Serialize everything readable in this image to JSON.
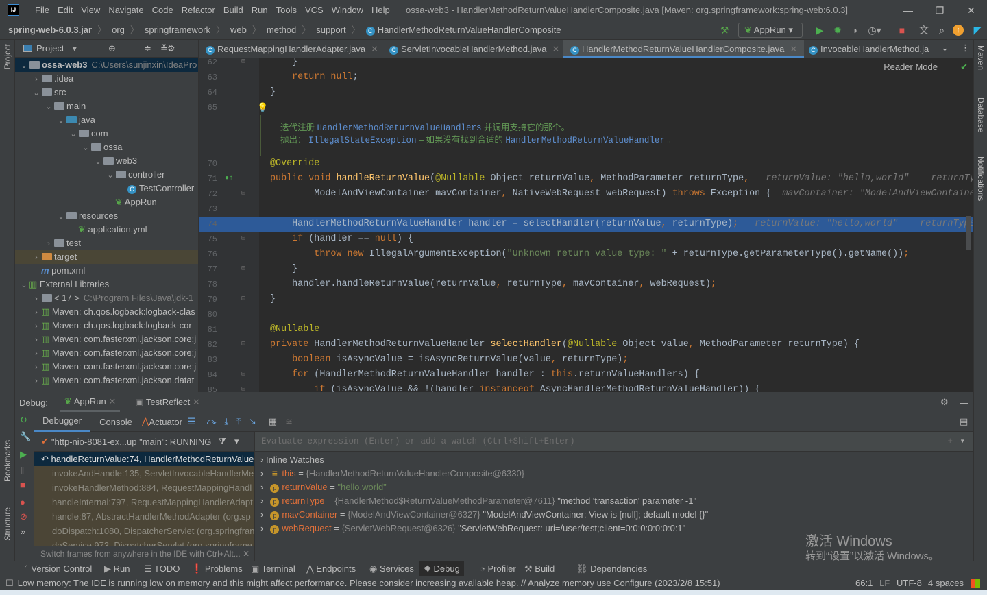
{
  "menubar": {
    "items": [
      "File",
      "Edit",
      "View",
      "Navigate",
      "Code",
      "Refactor",
      "Build",
      "Run",
      "Tools",
      "VCS",
      "Window",
      "Help"
    ],
    "title": "ossa-web3 - HandlerMethodReturnValueHandlerComposite.java [Maven: org.springframework:spring-web:6.0.3]"
  },
  "breadcrumb": [
    "spring-web-6.0.3.jar",
    "org",
    "springframework",
    "web",
    "method",
    "support",
    "HandlerMethodReturnValueHandlerComposite"
  ],
  "toolbar": {
    "run_config": "AppRun"
  },
  "left_strip": {
    "project": "Project",
    "bookmarks": "Bookmarks",
    "structure": "Structure"
  },
  "right_strip": {
    "maven": "Maven",
    "database": "Database",
    "notifications": "Notifications"
  },
  "project": {
    "title": "Project",
    "tree": [
      {
        "label": "ossa-web3",
        "hint": "C:\\Users\\sunjinxin\\IdeaPro",
        "d": 0,
        "a": "open",
        "icon": "module",
        "sel": true,
        "bold": true
      },
      {
        "label": ".idea",
        "d": 1,
        "a": "closed",
        "icon": "folder"
      },
      {
        "label": "src",
        "d": 1,
        "a": "open",
        "icon": "folder"
      },
      {
        "label": "main",
        "d": 2,
        "a": "open",
        "icon": "folder"
      },
      {
        "label": "java",
        "d": 3,
        "a": "open",
        "icon": "src-folder"
      },
      {
        "label": "com",
        "d": 4,
        "a": "open",
        "icon": "package"
      },
      {
        "label": "ossa",
        "d": 5,
        "a": "open",
        "icon": "package"
      },
      {
        "label": "web3",
        "d": 6,
        "a": "open",
        "icon": "package"
      },
      {
        "label": "controller",
        "d": 7,
        "a": "open",
        "icon": "package"
      },
      {
        "label": "TestController",
        "d": 8,
        "a": "none",
        "icon": "class"
      },
      {
        "label": "AppRun",
        "d": 7,
        "a": "none",
        "icon": "spring"
      },
      {
        "label": "resources",
        "d": 3,
        "a": "open",
        "icon": "res-folder"
      },
      {
        "label": "application.yml",
        "d": 4,
        "a": "none",
        "icon": "yml"
      },
      {
        "label": "test",
        "d": 2,
        "a": "closed",
        "icon": "folder"
      },
      {
        "label": "target",
        "d": 1,
        "a": "closed",
        "icon": "excluded-folder",
        "exc": true
      },
      {
        "label": "pom.xml",
        "d": 1,
        "a": "none",
        "icon": "maven"
      },
      {
        "label": "External Libraries",
        "d": 0,
        "a": "open",
        "icon": "libraries"
      },
      {
        "label": "< 17 >",
        "hint": "C:\\Program Files\\Java\\jdk-1",
        "d": 1,
        "a": "closed",
        "icon": "jdk"
      },
      {
        "label": "Maven: ch.qos.logback:logback-clas",
        "d": 1,
        "a": "closed",
        "icon": "lib"
      },
      {
        "label": "Maven: ch.qos.logback:logback-cor",
        "d": 1,
        "a": "closed",
        "icon": "lib"
      },
      {
        "label": "Maven: com.fasterxml.jackson.core:j",
        "d": 1,
        "a": "closed",
        "icon": "lib"
      },
      {
        "label": "Maven: com.fasterxml.jackson.core:j",
        "d": 1,
        "a": "closed",
        "icon": "lib"
      },
      {
        "label": "Maven: com.fasterxml.jackson.core:j",
        "d": 1,
        "a": "closed",
        "icon": "lib"
      },
      {
        "label": "Maven: com.fasterxml.jackson.datat",
        "d": 1,
        "a": "closed",
        "icon": "lib"
      }
    ]
  },
  "tabs": [
    {
      "label": "RequestMappingHandlerAdapter.java",
      "active": false
    },
    {
      "label": "ServletInvocableHandlerMethod.java",
      "active": false
    },
    {
      "label": "HandlerMethodReturnValueHandlerComposite.java",
      "active": true
    },
    {
      "label": "InvocableHandlerMethod.ja",
      "active": false
    }
  ],
  "editor": {
    "reader_mode": "Reader Mode",
    "doc": {
      "line1": [
        "迭代注册 ",
        "HandlerMethodReturnValueHandlers",
        " 并调用支持它的那个。"
      ],
      "line2": [
        "抛出： ",
        "IllegalStateException",
        " – 如果没有找到合适的 ",
        "HandlerMethodReturnValueHandler",
        " 。"
      ]
    },
    "lines": [
      {
        "n": "62",
        "t": [
          [
            "tx",
            "    }"
          ]
        ]
      },
      {
        "n": "63",
        "t": [
          [
            "kw",
            "    return null"
          ],
          [
            "tx",
            ";"
          ]
        ]
      },
      {
        "n": "64",
        "t": [
          [
            "tx",
            "}"
          ]
        ]
      },
      {
        "n": "65",
        "t": []
      },
      {
        "doc": true
      },
      {
        "n": "70",
        "t": [
          [
            "an",
            "@Override"
          ]
        ]
      },
      {
        "n": "71",
        "t": [
          [
            "kw",
            "public void "
          ],
          [
            "fn",
            "handleReturnValue"
          ],
          [
            "tx",
            "("
          ],
          [
            "an",
            "@Nullable"
          ],
          [
            "tx",
            " Object returnValue"
          ],
          [
            "kw",
            ", "
          ],
          [
            "tx",
            "MethodParameter returnType"
          ],
          [
            "kw",
            ","
          ],
          [
            "ih",
            "   returnValue: \"hello,world\"    returnTyp"
          ]
        ]
      },
      {
        "n": "72",
        "t": [
          [
            "tx",
            "        ModelAndViewContainer mavContainer"
          ],
          [
            "kw",
            ", "
          ],
          [
            "tx",
            "NativeWebRequest webRequest) "
          ],
          [
            "kw",
            "throws "
          ],
          [
            "tx",
            "Exception {"
          ],
          [
            "ih",
            "  mavContainer: \"ModelAndViewContaine"
          ]
        ]
      },
      {
        "n": "73",
        "t": []
      },
      {
        "n": "74",
        "hl": true,
        "t": [
          [
            "tx",
            "    HandlerMethodReturnValueHandler handler = selectHandler(returnValue"
          ],
          [
            "kw",
            ", "
          ],
          [
            "tx",
            "returnType)"
          ],
          [
            "kw",
            ";"
          ],
          [
            "ih",
            "   returnValue: \"hello,world\"    returnType:"
          ]
        ]
      },
      {
        "n": "75",
        "t": [
          [
            "kw",
            "    if "
          ],
          [
            "tx",
            "(handler == "
          ],
          [
            "kw",
            "null"
          ],
          [
            "tx",
            ") {"
          ]
        ]
      },
      {
        "n": "76",
        "t": [
          [
            "kw",
            "        throw new "
          ],
          [
            "tx",
            "IllegalArgumentException("
          ],
          [
            "str",
            "\"Unknown return value type: \""
          ],
          [
            "tx",
            " + returnType.getParameterType().getName())"
          ],
          [
            "kw",
            ";"
          ]
        ]
      },
      {
        "n": "77",
        "t": [
          [
            "tx",
            "    }"
          ]
        ]
      },
      {
        "n": "78",
        "t": [
          [
            "tx",
            "    handler.handleReturnValue(returnValue"
          ],
          [
            "kw",
            ", "
          ],
          [
            "tx",
            "returnType"
          ],
          [
            "kw",
            ", "
          ],
          [
            "tx",
            "mavContainer"
          ],
          [
            "kw",
            ", "
          ],
          [
            "tx",
            "webRequest)"
          ],
          [
            "kw",
            ";"
          ]
        ]
      },
      {
        "n": "79",
        "t": [
          [
            "tx",
            "}"
          ]
        ]
      },
      {
        "n": "80",
        "t": []
      },
      {
        "n": "81",
        "t": [
          [
            "an",
            "@Nullable"
          ]
        ]
      },
      {
        "n": "82",
        "t": [
          [
            "kw",
            "private "
          ],
          [
            "tx",
            "HandlerMethodReturnValueHandler "
          ],
          [
            "fn",
            "selectHandler"
          ],
          [
            "tx",
            "("
          ],
          [
            "an",
            "@Nullable"
          ],
          [
            "tx",
            " Object value"
          ],
          [
            "kw",
            ", "
          ],
          [
            "tx",
            "MethodParameter returnType) {"
          ]
        ]
      },
      {
        "n": "83",
        "t": [
          [
            "kw",
            "    boolean "
          ],
          [
            "tx",
            "isAsyncValue = isAsyncReturnValue(value"
          ],
          [
            "kw",
            ", "
          ],
          [
            "tx",
            "returnType)"
          ],
          [
            "kw",
            ";"
          ]
        ]
      },
      {
        "n": "84",
        "t": [
          [
            "kw",
            "    for "
          ],
          [
            "tx",
            "(HandlerMethodReturnValueHandler handler : "
          ],
          [
            "kw",
            "this"
          ],
          [
            "tx",
            ".returnValueHandlers) {"
          ]
        ]
      },
      {
        "n": "85",
        "t": [
          [
            "kw",
            "        if "
          ],
          [
            "tx",
            "(isAsyncValue && !(handler "
          ],
          [
            "kw",
            "instanceof "
          ],
          [
            "tx",
            "AsyncHandlerMethodReturnValueHandler)) {"
          ]
        ]
      }
    ]
  },
  "debug": {
    "label": "Debug:",
    "sessions": [
      "AppRun",
      "TestReflect"
    ],
    "tabs": [
      "Debugger",
      "Console",
      "Actuator"
    ],
    "thread": "\"http-nio-8081-ex...up \"main\": RUNNING",
    "frames": [
      {
        "text": "handleReturnValue:74, HandlerMethodReturnValue",
        "sel": true
      },
      {
        "text": "invokeAndHandle:135, ServletInvocableHandlerMet"
      },
      {
        "text": "invokeHandlerMethod:884, RequestMappingHandl"
      },
      {
        "text": "handleInternal:797, RequestMappingHandlerAdapt"
      },
      {
        "text": "handle:87, AbstractHandlerMethodAdapter (org.sp"
      },
      {
        "text": "doDispatch:1080, DispatcherServlet (org.springfran"
      },
      {
        "text": "doService:973, DispatcherServlet (org.springframe"
      }
    ],
    "frames_tip": "Switch frames from anywhere in the IDE with Ctrl+Alt...",
    "eval_placeholder": "Evaluate expression (Enter) or add a watch (Ctrl+Shift+Enter)",
    "inline_watches": "Inline Watches",
    "vars": [
      {
        "name": "this",
        "kind": "this",
        "value": "{HandlerMethodReturnValueHandlerComposite@6330}",
        "extra": ""
      },
      {
        "name": "returnValue",
        "kind": "param",
        "value": "",
        "str": "\"hello,world\"",
        "extra": ""
      },
      {
        "name": "returnType",
        "kind": "param",
        "value": "{HandlerMethod$ReturnValueMethodParameter@7611}",
        "extra": "\"method 'transaction' parameter -1\""
      },
      {
        "name": "mavContainer",
        "kind": "param",
        "value": "{ModelAndViewContainer@6327}",
        "extra": "\"ModelAndViewContainer: View is [null]; default model {}\""
      },
      {
        "name": "webRequest",
        "kind": "param",
        "value": "{ServletWebRequest@6326}",
        "extra": "\"ServletWebRequest: uri=/user/test;client=0:0:0:0:0:0:0:1\""
      }
    ]
  },
  "watermark": {
    "line1": "激活 Windows",
    "line2": "转到“设置”以激活 Windows。"
  },
  "bottom_tools": [
    {
      "label": "Version Control",
      "icon": "vcs-icon"
    },
    {
      "label": "Run",
      "icon": "run-icon"
    },
    {
      "label": "TODO",
      "icon": "todo-icon"
    },
    {
      "label": "Problems",
      "icon": "problems-icon"
    },
    {
      "label": "Terminal",
      "icon": "terminal-icon"
    },
    {
      "label": "Endpoints",
      "icon": "endpoints-icon"
    },
    {
      "label": "Services",
      "icon": "services-icon"
    },
    {
      "label": "Debug",
      "icon": "debug-icon",
      "active": true
    },
    {
      "label": "Profiler",
      "icon": "profiler-icon"
    },
    {
      "label": "Build",
      "icon": "build-icon"
    },
    {
      "label": "Dependencies",
      "icon": "dependencies-icon"
    }
  ],
  "status": {
    "message": "Low memory: The IDE is running low on memory and this might affect performance. Please consider increasing available heap. // Analyze memory use   Configure (2023/2/8 15:51)",
    "position": "66:1",
    "line_sep": "LF",
    "encoding": "UTF-8",
    "indent": "4 spaces"
  },
  "colors": {
    "accent": "#4a88c7",
    "highlight_line": "#2d5a98",
    "keyword": "#cc7832",
    "function": "#ffc66d",
    "string": "#6a8759"
  }
}
